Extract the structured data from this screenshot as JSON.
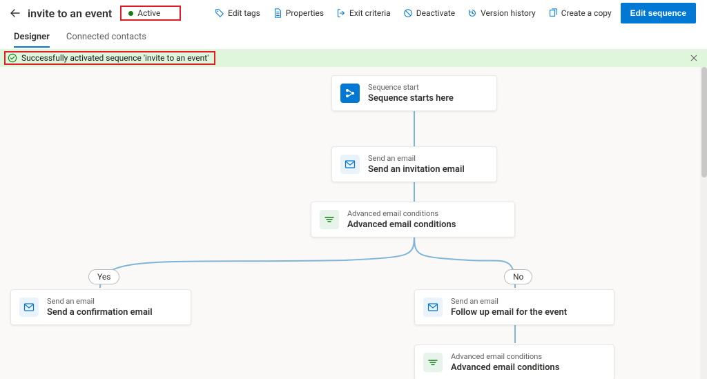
{
  "header": {
    "title": "invite to an event",
    "status_label": "Active",
    "actions": {
      "edit_tags": "Edit tags",
      "properties": "Properties",
      "exit_criteria": "Exit criteria",
      "deactivate": "Deactivate",
      "version_history": "Version history",
      "create_copy": "Create a copy",
      "edit_sequence": "Edit sequence"
    }
  },
  "tabs": {
    "designer": "Designer",
    "connected_contacts": "Connected contacts"
  },
  "notice": {
    "text": "Successfully activated sequence 'invite to an event'"
  },
  "branches": {
    "yes": "Yes",
    "no": "No"
  },
  "nodes": {
    "start": {
      "small": "Sequence start",
      "big": "Sequence starts here"
    },
    "email1": {
      "small": "Send an email",
      "big": "Send an invitation email"
    },
    "cond1": {
      "small": "Advanced email conditions",
      "big": "Advanced email conditions"
    },
    "emailYes": {
      "small": "Send an email",
      "big": "Send a confirmation email"
    },
    "emailNo": {
      "small": "Send an email",
      "big": "Follow up email for the event"
    },
    "cond2": {
      "small": "Advanced email conditions",
      "big": "Advanced email conditions"
    }
  }
}
